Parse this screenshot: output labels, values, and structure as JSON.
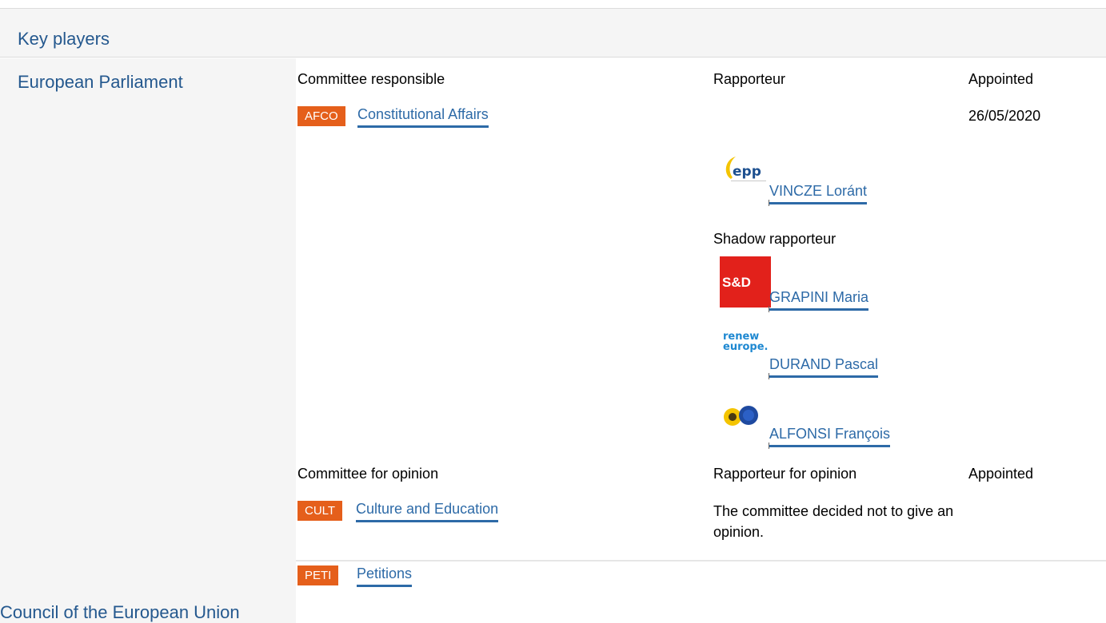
{
  "section": {
    "title": "Key players"
  },
  "institutions": {
    "ep": "European Parliament",
    "council": "Council of the European Union"
  },
  "responsible": {
    "header_committee": "Committee responsible",
    "header_rapporteur": "Rapporteur",
    "header_appointed": "Appointed",
    "committee": {
      "code": "AFCO",
      "name": "Constitutional Affairs"
    },
    "appointed_date": "26/05/2020",
    "rapporteur": {
      "name": "VINCZE Loránt",
      "group_logo": "epp-logo"
    },
    "shadow_label": "Shadow rapporteur",
    "shadows": [
      {
        "name": "GRAPINI Maria",
        "group_logo": "s-and-d-logo",
        "logo_text": "S&D"
      },
      {
        "name": "DURAND Pascal",
        "group_logo": "renew-europe-logo",
        "logo_text": "renew europe."
      },
      {
        "name": "ALFONSI François",
        "group_logo": "greens-efa-logo"
      }
    ]
  },
  "opinion": {
    "header_committee": "Committee for opinion",
    "header_rapporteur": "Rapporteur for opinion",
    "header_appointed": "Appointed",
    "committees": [
      {
        "code": "CULT",
        "name": "Culture and Education",
        "note": "The committee decided not to give an opinion."
      },
      {
        "code": "PETI",
        "name": "Petitions"
      }
    ]
  },
  "colors": {
    "badge": "#e55f1b",
    "link": "#2d6aa7",
    "heading": "#24588e",
    "panel_bg": "#f5f5f5"
  }
}
